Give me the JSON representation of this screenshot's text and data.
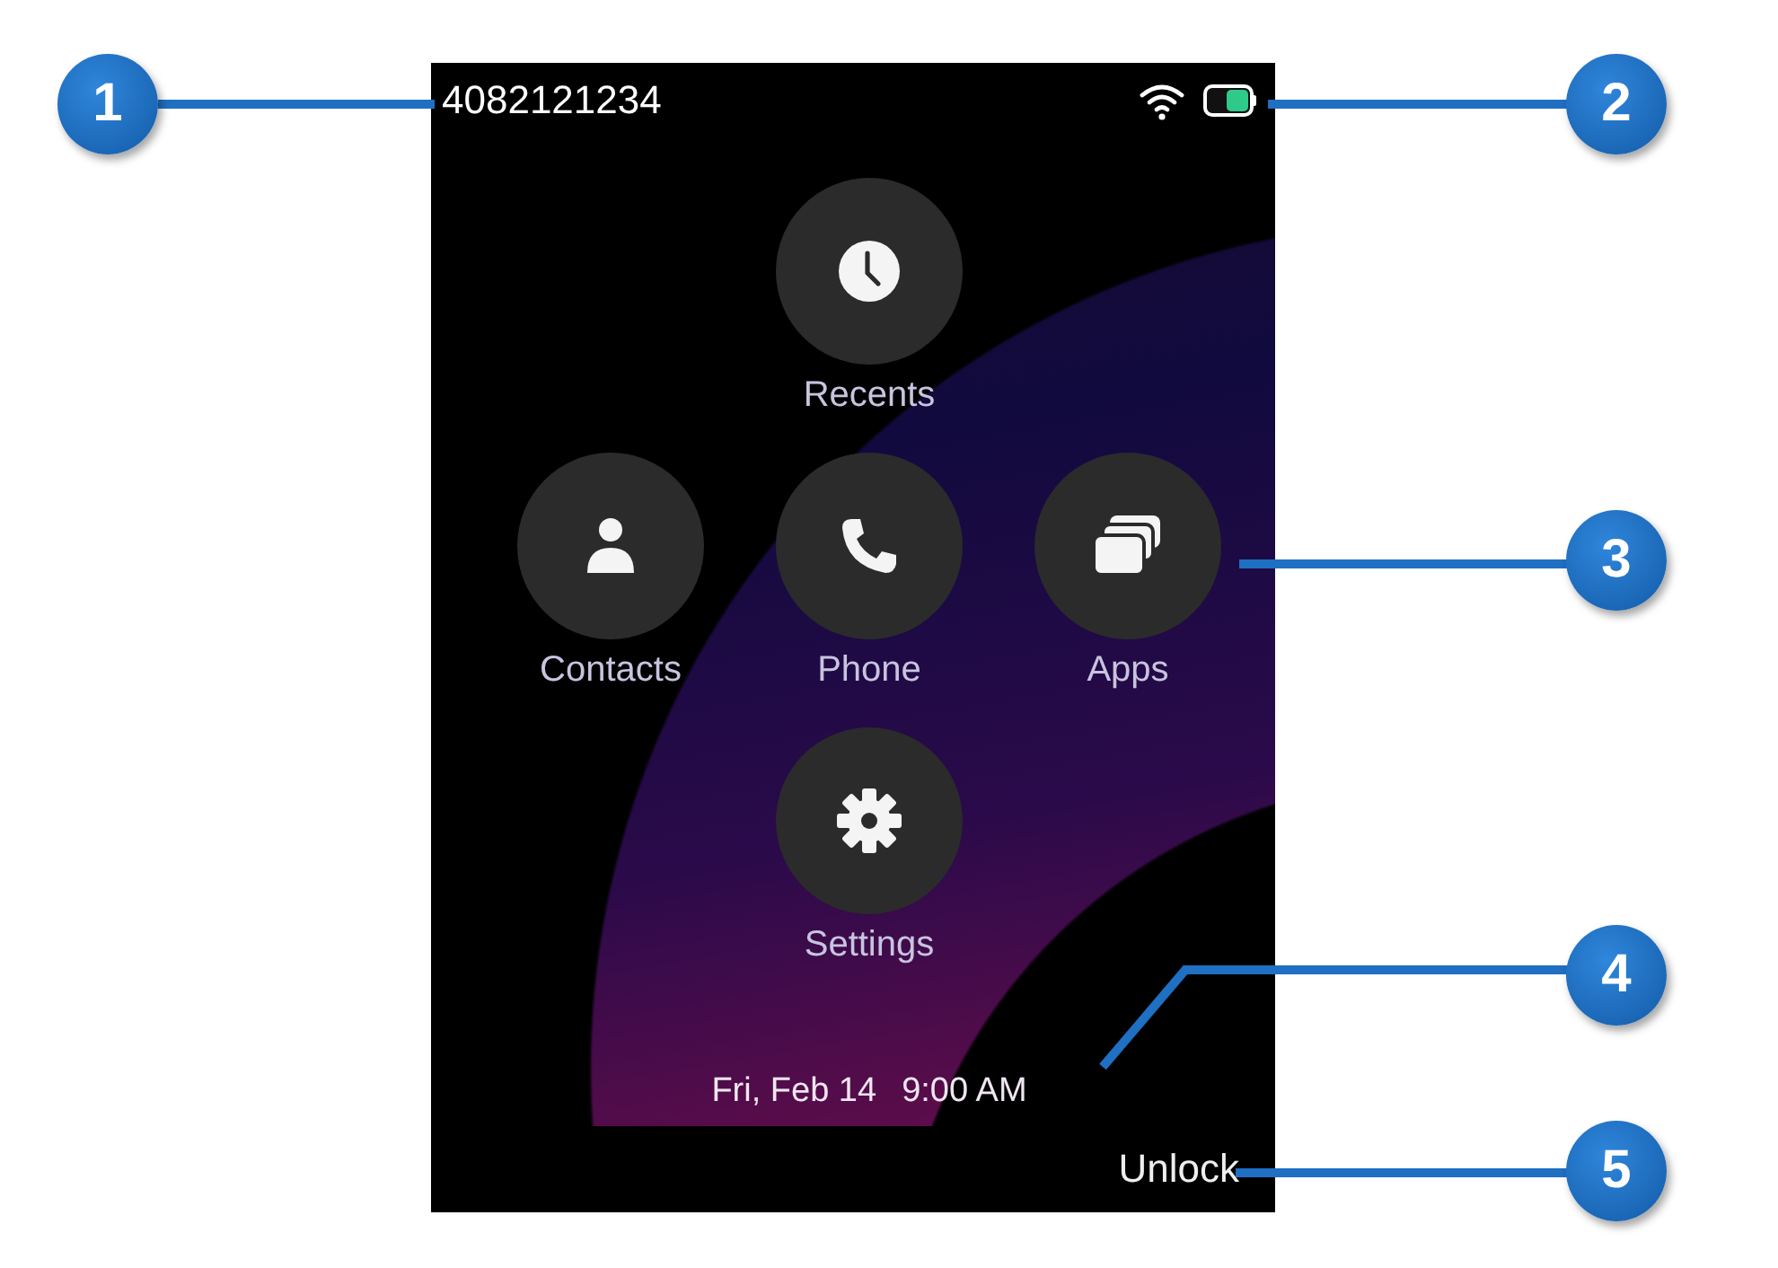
{
  "status_bar": {
    "line_number": "4082121234"
  },
  "app_rows": [
    [
      {
        "label": "Recents",
        "kind": "recents"
      }
    ],
    [
      {
        "label": "Contacts",
        "kind": "contacts"
      },
      {
        "label": "Phone",
        "kind": "phone"
      },
      {
        "label": "Apps",
        "kind": "apps"
      }
    ],
    [
      {
        "label": "Settings",
        "kind": "settings"
      }
    ]
  ],
  "date": "Fri, Feb 14",
  "time": "9:00 AM",
  "softkey": "Unlock",
  "callouts": [
    "1",
    "2",
    "3",
    "4",
    "5"
  ]
}
